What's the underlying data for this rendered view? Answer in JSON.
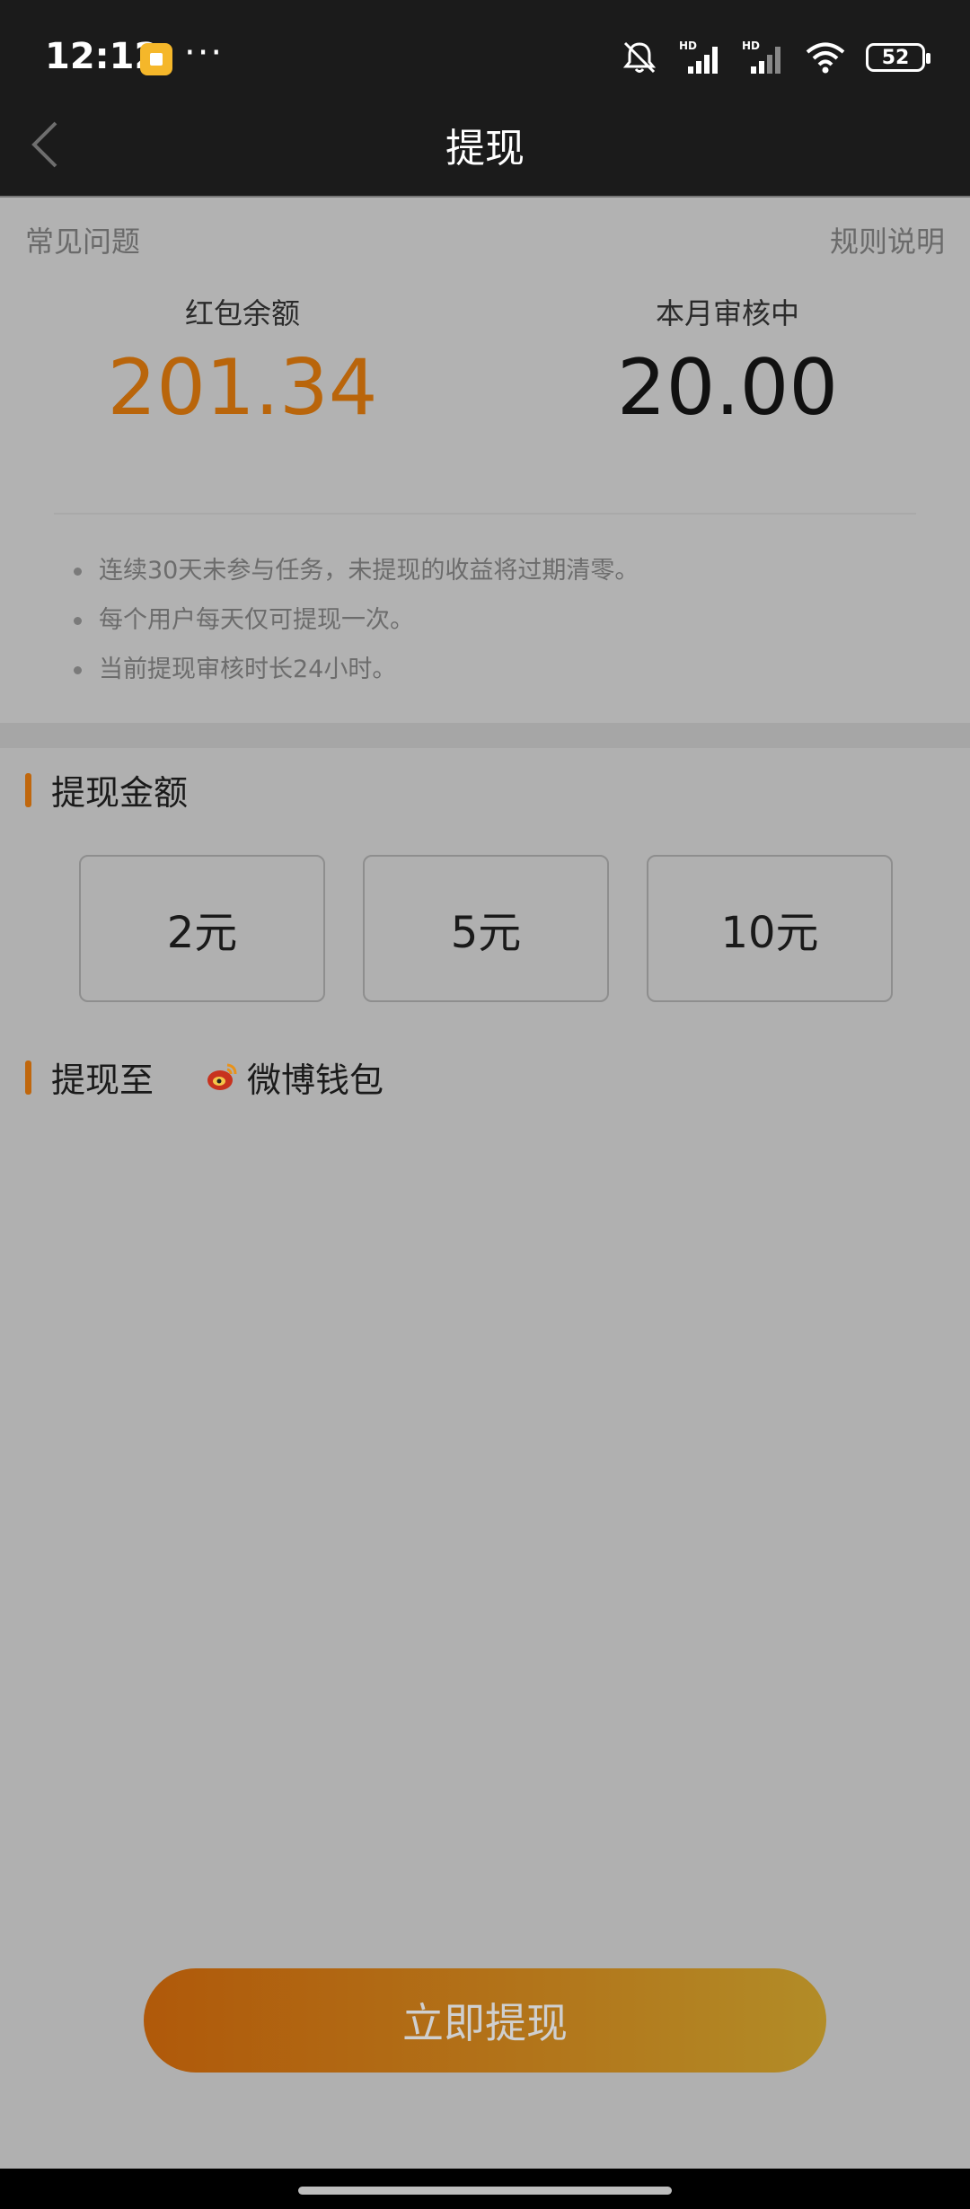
{
  "status_bar": {
    "time": "12:12",
    "more": "···",
    "battery": "52",
    "icons": [
      "app-notification-icon",
      "mute-icon",
      "signal-hd-icon",
      "signal-hd-icon",
      "wifi-icon",
      "battery-icon"
    ]
  },
  "nav": {
    "title": "提现",
    "back_icon": "chevron-left-icon"
  },
  "top": {
    "faq": "常见问题",
    "rules": "规则说明",
    "balance_label": "红包余额",
    "balance_value": "201.34",
    "pending_label": "本月审核中",
    "pending_value": "20.00",
    "notes": [
      "连续30天未参与任务，未提现的收益将过期清零。",
      "每个用户每天仅可提现一次。",
      "当前提现审核时长24小时。"
    ]
  },
  "amount": {
    "title": "提现金额",
    "options": [
      "2元",
      "5元",
      "10元"
    ]
  },
  "destination": {
    "title": "提现至",
    "wallet": "微博钱包",
    "wallet_icon": "weibo-wallet-icon"
  },
  "action": {
    "withdraw": "立即提现"
  },
  "colors": {
    "accent": "#b9650b",
    "background": "#b0b0b0",
    "header": "#1b1b1b"
  }
}
